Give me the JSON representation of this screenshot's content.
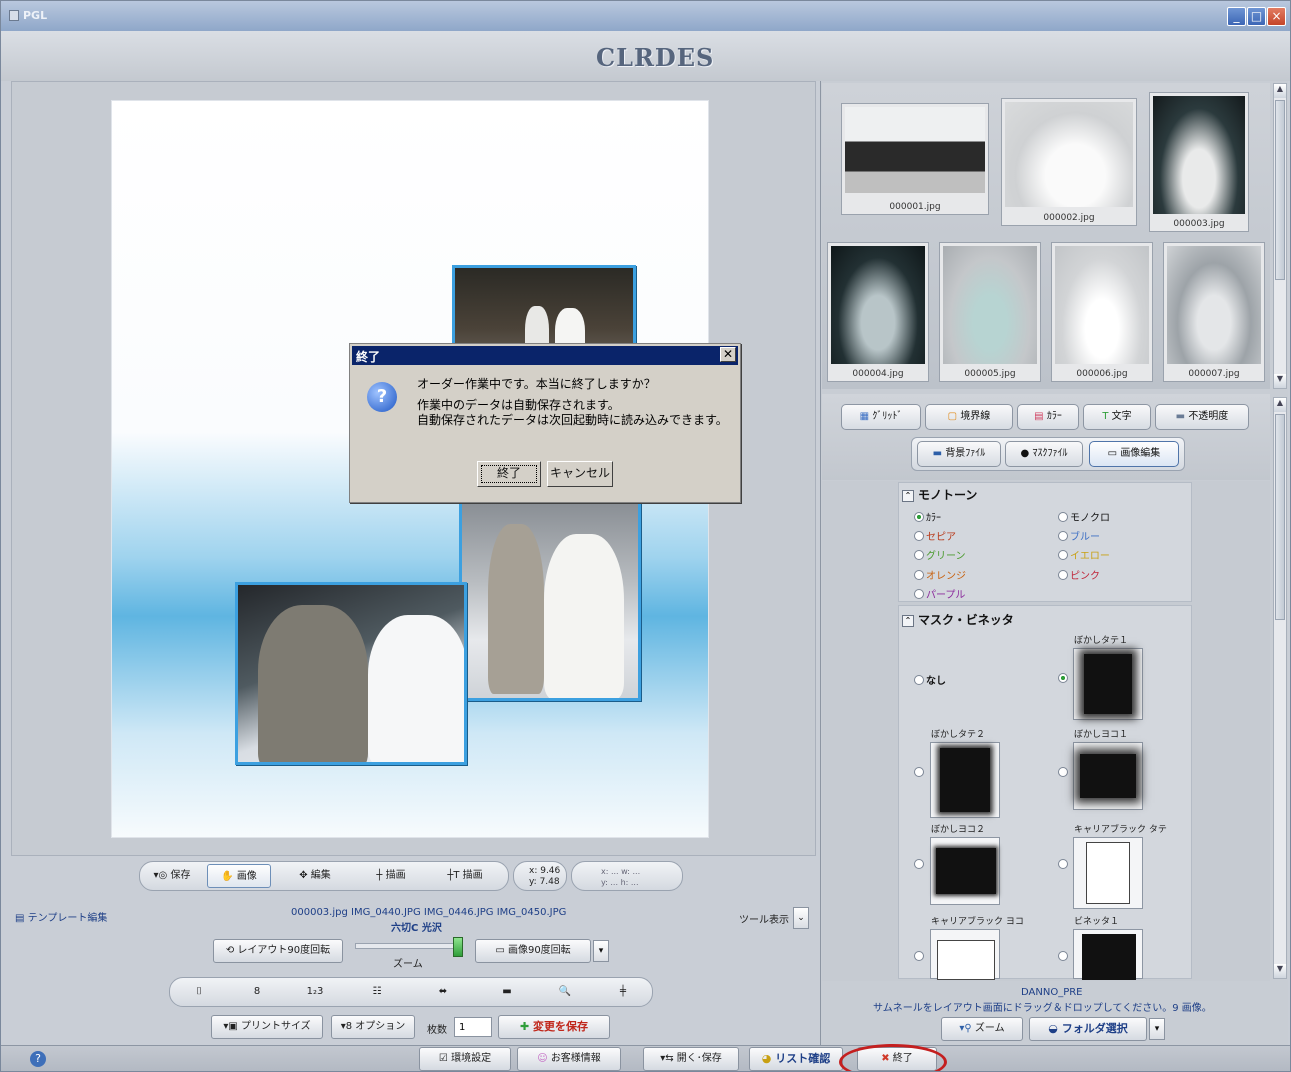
{
  "window": {
    "title": "PGL",
    "brand": "CLRDES",
    "min_icon": "minimize-icon",
    "max_icon": "maximize-icon",
    "close_icon": "close-icon"
  },
  "dialog": {
    "title": "終了",
    "close_glyph": "✕",
    "line1": "オーダー作業中です。本当に終了しますか？",
    "line2": "作業中のデータは自動保存されます。",
    "line3": "自動保存されたデータは次回起動時に読み込みできます。",
    "ok": "終了",
    "cancel": "キャンセル"
  },
  "tools": {
    "save": "保存",
    "image": "画像",
    "edit": "編集",
    "draw": "描画",
    "text_draw": "描画",
    "coord_x": "x: 9.46",
    "coord_y": "y: 7.48",
    "dims_top": "x: ... w: ...",
    "dims_bottom": "y: ... h: ..."
  },
  "info": {
    "template_edit": "テンプレート編集",
    "files": "000003.jpg IMG_0440.JPG IMG_0446.JPG IMG_0450.JPG",
    "size_name": "六切C 光沢",
    "tool_display": "ツール表示"
  },
  "controls": {
    "layout_rotate": "レイアウト90度回転",
    "zoom": "ズーム",
    "image_rotate": "画像90度回転",
    "print_size": "プリントサイズ",
    "option": "オプション",
    "count_label": "枚数",
    "count_value": "1",
    "save_changes": "変更を保存"
  },
  "footer": {
    "env": "環境設定",
    "customer": "お客様情報",
    "open_save": "開く･保存",
    "list_confirm": "リスト確認",
    "exit": "終了"
  },
  "thumbnails": [
    {
      "caption": "000001.jpg"
    },
    {
      "caption": "000002.jpg"
    },
    {
      "caption": "000003.jpg"
    },
    {
      "caption": "000004.jpg"
    },
    {
      "caption": "000005.jpg"
    },
    {
      "caption": "000006.jpg"
    },
    {
      "caption": "000007.jpg"
    }
  ],
  "tabs": {
    "grid": "ｸﾞﾘｯﾄﾞ",
    "border": "境界線",
    "color": "ｶﾗｰ",
    "text": "文字",
    "opacity": "不透明度",
    "bg_file": "背景ﾌｧｲﾙ",
    "mask_file": "ﾏｽｸﾌｧｲﾙ",
    "image_edit": "画像編集"
  },
  "monotone": {
    "heading": "モノトーン",
    "options": [
      "ｶﾗｰ",
      "モノクロ",
      "セピア",
      "ブルー",
      "グリーン",
      "イエロー",
      "オレンジ",
      "ピンク",
      "パープル"
    ],
    "option_colors": [
      "#111111",
      "#111111",
      "#b83a1a",
      "#3c6fc4",
      "#4a9a2d",
      "#c8a012",
      "#c8610f",
      "#c0263a",
      "#8b2a9c"
    ],
    "selected": "ｶﾗｰ"
  },
  "mask": {
    "heading": "マスク・ビネッタ",
    "none": "なし",
    "items": [
      "ぼかしタテ１",
      "ぼかしタテ２",
      "ぼかしヨコ１",
      "ぼかしヨコ２",
      "キャリアブラック タテ",
      "キャリアブラック ヨコ",
      "ビネッタ１"
    ]
  },
  "folder": {
    "name": "DANNO_PRE",
    "hint": "サムネールをレイアウト画面にドラッグ＆ドロップしてください。9 画像。",
    "zoom": "ズーム",
    "folder_select": "フォルダ選択"
  }
}
